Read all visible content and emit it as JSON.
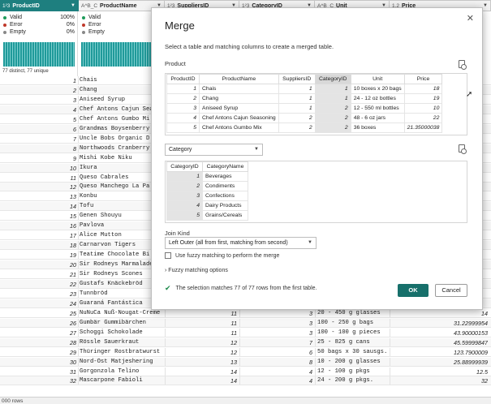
{
  "grid": {
    "columns": [
      {
        "type": "1²3",
        "name": "ProductID"
      },
      {
        "type": "A^B_C",
        "name": "ProductName"
      },
      {
        "type": "1²3",
        "name": "SuppliersID"
      },
      {
        "type": "1²3",
        "name": "CategoryID"
      },
      {
        "type": "A^B_C",
        "name": "Unit"
      },
      {
        "type": "1.2",
        "name": "Price"
      }
    ],
    "profile": {
      "valid_label": "Valid",
      "valid_pct": "100%",
      "error_label": "Error",
      "error_pct": "0%",
      "empty_label": "Empty",
      "empty_pct": "0%",
      "footer": "77 distinct, 77 unique",
      "valid_color": "#1e9b5a",
      "error_color": "#c0392b",
      "empty_color": "#888888"
    },
    "rows": [
      {
        "id": "1",
        "name": "Chais"
      },
      {
        "id": "2",
        "name": "Chang"
      },
      {
        "id": "3",
        "name": "Aniseed Syrup"
      },
      {
        "id": "4",
        "name": "Chef Antons Cajun Sea"
      },
      {
        "id": "5",
        "name": "Chef Antons Gumbo Mi"
      },
      {
        "id": "6",
        "name": "Grandmas Boysenberry"
      },
      {
        "id": "7",
        "name": "Uncle Bobs Organic D"
      },
      {
        "id": "8",
        "name": "Northwoods Cranberry"
      },
      {
        "id": "9",
        "name": "Mishi Kobe Niku"
      },
      {
        "id": "10",
        "name": "Ikura"
      },
      {
        "id": "11",
        "name": "Queso Cabrales"
      },
      {
        "id": "12",
        "name": "Queso Manchego La Pa"
      },
      {
        "id": "13",
        "name": "Konbu"
      },
      {
        "id": "14",
        "name": "Tofu"
      },
      {
        "id": "15",
        "name": "Genen Shouyu"
      },
      {
        "id": "16",
        "name": "Pavlova"
      },
      {
        "id": "17",
        "name": "Alice Mutton"
      },
      {
        "id": "18",
        "name": "Carnarvon Tigers"
      },
      {
        "id": "19",
        "name": "Teatime Chocolate Bi"
      },
      {
        "id": "20",
        "name": "Sir Rodneys Marmalade"
      },
      {
        "id": "21",
        "name": "Sir Rodneys Scones"
      },
      {
        "id": "22",
        "name": "Gustafs Knäckebröd"
      },
      {
        "id": "23",
        "name": "Tunnbröd"
      },
      {
        "id": "24",
        "name": "Guaraná Fantástica"
      },
      {
        "id": "25",
        "name": "NuNuCa Nuß-Nougat-Creme",
        "sup": "11",
        "cat": "3",
        "unit": "20 - 450 g glasses",
        "price": "14"
      },
      {
        "id": "26",
        "name": "Gumbär Gummibärchen",
        "sup": "11",
        "cat": "3",
        "unit": "100 - 250 g bags",
        "price": "31.22999954"
      },
      {
        "id": "27",
        "name": "Schoggi Schokolade",
        "sup": "11",
        "cat": "3",
        "unit": "100 - 100 g pieces",
        "price": "43.90000153"
      },
      {
        "id": "28",
        "name": "Rössle Sauerkraut",
        "sup": "12",
        "cat": "7",
        "unit": "25 - 825 g cans",
        "price": "45.59999847"
      },
      {
        "id": "29",
        "name": "Thüringer Rostbratwurst",
        "sup": "12",
        "cat": "6",
        "unit": "50 bags x 30 sausgs.",
        "price": "123.7900009"
      },
      {
        "id": "30",
        "name": "Nord-Ost Matjeshering",
        "sup": "13",
        "cat": "8",
        "unit": "10 - 200 g glasses",
        "price": "25.88999939"
      },
      {
        "id": "31",
        "name": "Gorgonzola Telino",
        "sup": "14",
        "cat": "4",
        "unit": "12 - 100 g pkgs",
        "price": "12.5"
      },
      {
        "id": "32",
        "name": "Mascarpone Fabioli",
        "sup": "14",
        "cat": "4",
        "unit": "24 - 200 g pkgs.",
        "price": "32"
      }
    ],
    "status": "000 rows"
  },
  "dialog": {
    "title": "Merge",
    "close_glyph": "✕",
    "description": "Select a table and matching columns to create a merged table.",
    "first_table_label": "Product",
    "product_table": {
      "headers": [
        "ProductID",
        "ProductName",
        "SuppliersID",
        "CategoryID",
        "Unit",
        "Price"
      ],
      "rows": [
        [
          "1",
          "Chais",
          "1",
          "1",
          "10 boxes x 20 bags",
          "18"
        ],
        [
          "2",
          "Chang",
          "1",
          "1",
          "24 - 12 oz bottles",
          "19"
        ],
        [
          "3",
          "Aniseed Syrup",
          "1",
          "2",
          "12 - 550 ml bottles",
          "10"
        ],
        [
          "4",
          "Chef Antons Cajun Seasoning",
          "2",
          "2",
          "48 - 6 oz jars",
          "22"
        ],
        [
          "5",
          "Chef Antons Gumbo Mix",
          "2",
          "2",
          "36 boxes",
          "21.35000038"
        ]
      ]
    },
    "second_table_select": "Category",
    "category_table": {
      "headers": [
        "CategoryID",
        "CategoryName"
      ],
      "rows": [
        [
          "1",
          "Beverages"
        ],
        [
          "2",
          "Condiments"
        ],
        [
          "3",
          "Confections"
        ],
        [
          "4",
          "Dairy Products"
        ],
        [
          "5",
          "Grains/Cereals"
        ]
      ]
    },
    "join_kind_label": "Join Kind",
    "join_kind_value": "Left Outer (all from first, matching from second)",
    "fuzzy_checkbox_label": "Use fuzzy matching to perform the merge",
    "fuzzy_options_label": "Fuzzy matching options",
    "match_message": "The selection matches 77 of 77 rows from the first table.",
    "ok_label": "OK",
    "cancel_label": "Cancel"
  }
}
